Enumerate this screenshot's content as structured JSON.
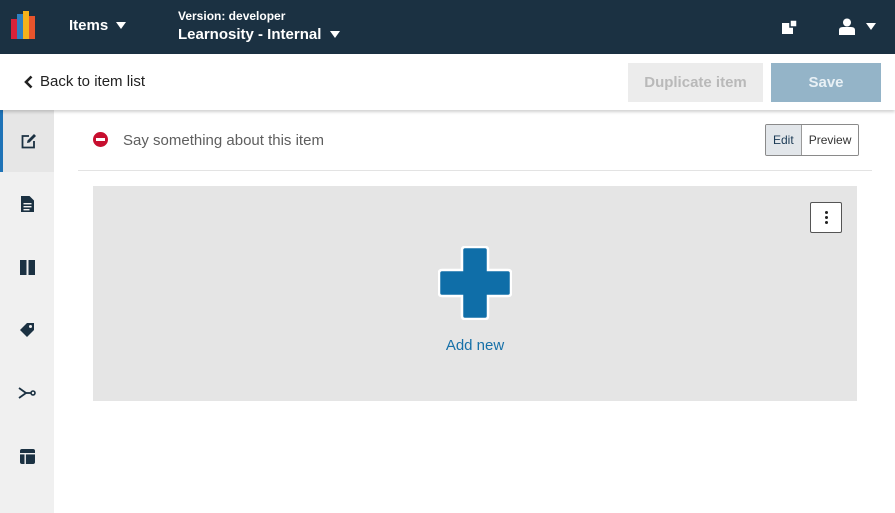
{
  "topbar": {
    "items_label": "Items",
    "version_label": "Version: developer",
    "org_name": "Learnosity - Internal",
    "icons": [
      "learnosity-logo-icon",
      "caret-down-icon",
      "layout-switch-icon",
      "user-icon"
    ]
  },
  "subbar": {
    "back_label": "Back to item list",
    "duplicate_label": "Duplicate item",
    "save_label": "Save"
  },
  "sidebar": {
    "items": [
      {
        "icon": "edit-icon",
        "active": true
      },
      {
        "icon": "document-icon",
        "active": false
      },
      {
        "icon": "book-icon",
        "active": false
      },
      {
        "icon": "tag-icon",
        "active": false
      },
      {
        "icon": "branch-icon",
        "active": false
      },
      {
        "icon": "layout-icon",
        "active": false
      }
    ]
  },
  "description": {
    "placeholder": "Say something about this item",
    "edit_label": "Edit",
    "preview_label": "Preview"
  },
  "canvas": {
    "add_label": "Add new"
  },
  "colors": {
    "topbar": "#1b3142",
    "accent_blue": "#0f6ea8",
    "danger_red": "#c70f2f",
    "save_disabled": "#94b4c8"
  }
}
